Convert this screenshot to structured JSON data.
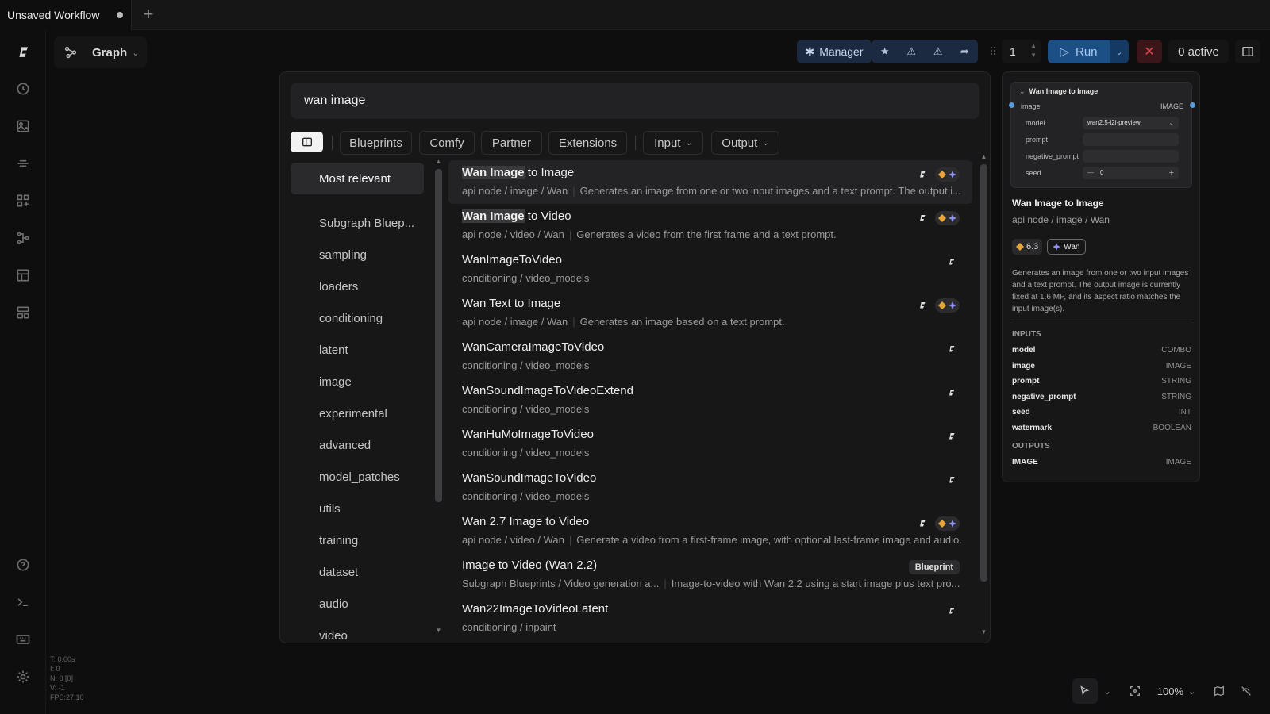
{
  "tabs": {
    "workflow_title": "Unsaved Workflow",
    "new_tab": "+"
  },
  "header": {
    "graph_label": "Graph"
  },
  "toolbar": {
    "manager_label": "Manager",
    "queue_count": "1",
    "run_label": "Run",
    "active_label": "0 active"
  },
  "search": {
    "query": "wan image"
  },
  "filters": {
    "chips": [
      "Blueprints",
      "Comfy",
      "Partner",
      "Extensions"
    ],
    "dropdowns": [
      "Input",
      "Output"
    ]
  },
  "categories": [
    "Most relevant",
    "Subgraph Bluep...",
    "sampling",
    "loaders",
    "conditioning",
    "latent",
    "image",
    "experimental",
    "advanced",
    "model_patches",
    "utils",
    "training",
    "dataset",
    "audio",
    "video"
  ],
  "results": [
    {
      "hl": "Wan Image",
      "title": " to Image",
      "category": "api node / image / Wan",
      "desc": "Generates an image from one or two input images and a text prompt. The output i...",
      "badges": "api"
    },
    {
      "hl": "Wan Image",
      "title": " to Video",
      "category": "api node / video / Wan",
      "desc": "Generates a video from the first frame and a text prompt.",
      "badges": "api"
    },
    {
      "hl": "",
      "title": "WanImageToVideo",
      "category": "conditioning / video_models",
      "desc": "",
      "badges": "core"
    },
    {
      "hl": "",
      "title": "Wan Text to Image",
      "category": "api node / image / Wan",
      "desc": "Generates an image based on a text prompt.",
      "badges": "api"
    },
    {
      "hl": "",
      "title": "WanCameraImageToVideo",
      "category": "conditioning / video_models",
      "desc": "",
      "badges": "core"
    },
    {
      "hl": "",
      "title": "WanSoundImageToVideoExtend",
      "category": "conditioning / video_models",
      "desc": "",
      "badges": "core"
    },
    {
      "hl": "",
      "title": "WanHuMoImageToVideo",
      "category": "conditioning / video_models",
      "desc": "",
      "badges": "core"
    },
    {
      "hl": "",
      "title": "WanSoundImageToVideo",
      "category": "conditioning / video_models",
      "desc": "",
      "badges": "core"
    },
    {
      "hl": "",
      "title": "Wan 2.7 Image to Video",
      "category": "api node / video / Wan",
      "desc": "Generate a video from a first-frame image, with optional last-frame image and audio.",
      "badges": "api"
    },
    {
      "hl": "",
      "title": "Image to Video (Wan 2.2)",
      "category": "Subgraph Blueprints / Video generation a...",
      "desc": "Image-to-video with Wan 2.2 using a start image plus text pro...",
      "badges": "blueprint"
    },
    {
      "hl": "",
      "title": "Wan22ImageToVideoLatent",
      "category": "conditioning / inpaint",
      "desc": "",
      "badges": "core"
    }
  ],
  "blueprint_badge": "Blueprint",
  "preview": {
    "card_title": "Wan Image to Image",
    "card_input": "image",
    "card_output": "IMAGE",
    "widgets": [
      {
        "label": "model",
        "value": "wan2.5-i2i-preview"
      },
      {
        "label": "prompt",
        "value": ""
      },
      {
        "label": "negative_prompt",
        "value": ""
      },
      {
        "label": "seed",
        "value": "0"
      }
    ],
    "title": "Wan Image to Image",
    "category": "api node / image / Wan",
    "price": "6.3",
    "provider": "Wan",
    "description": "Generates an image from one or two input images and a text prompt. The output image is currently fixed at 1.6 MP, and its aspect ratio matches the input image(s).",
    "inputs_heading": "INPUTS",
    "inputs": [
      {
        "name": "model",
        "type": "COMBO"
      },
      {
        "name": "image",
        "type": "IMAGE"
      },
      {
        "name": "prompt",
        "type": "STRING"
      },
      {
        "name": "negative_prompt",
        "type": "STRING"
      },
      {
        "name": "seed",
        "type": "INT"
      },
      {
        "name": "watermark",
        "type": "BOOLEAN"
      }
    ],
    "outputs_heading": "OUTPUTS",
    "outputs": [
      {
        "name": "IMAGE",
        "type": "IMAGE"
      }
    ]
  },
  "stats": [
    "T: 0.00s",
    "I: 0",
    "N: 0 [0]",
    "V: -1",
    "FPS:27.10"
  ],
  "zoom": "100%"
}
